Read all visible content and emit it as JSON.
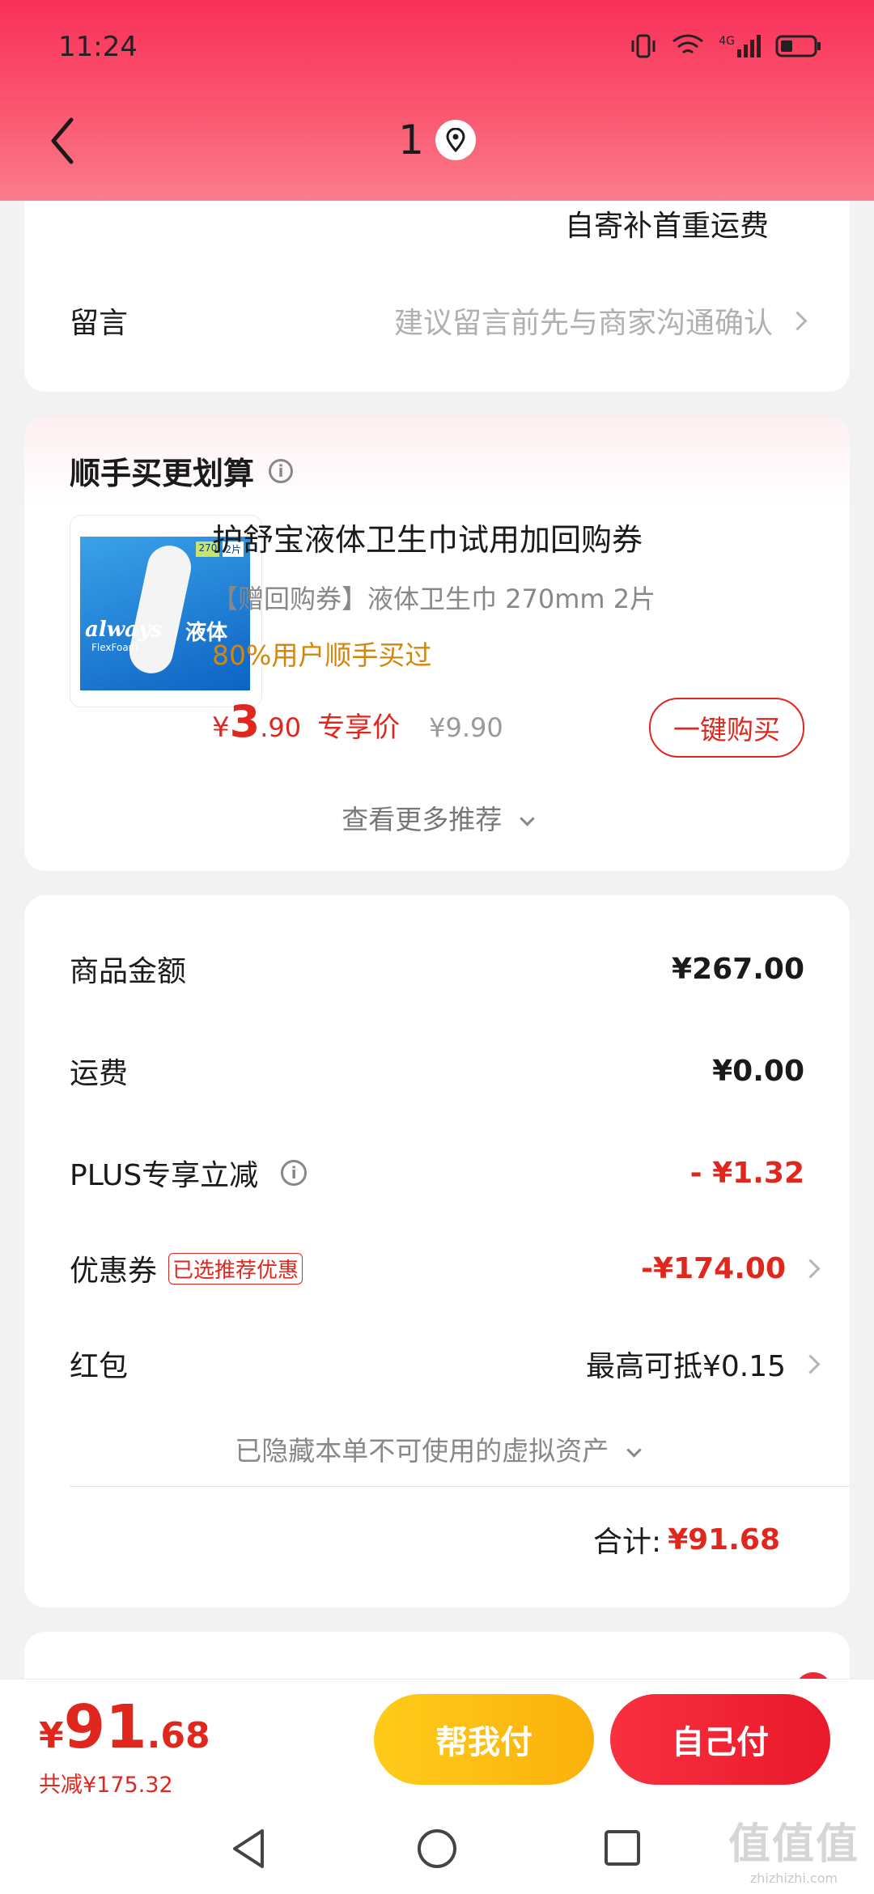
{
  "status": {
    "time": "11:24",
    "network": "4G"
  },
  "header": {
    "title": "1"
  },
  "address_card": {
    "shipping_note": "自寄补首重运费",
    "message_label": "留言",
    "message_placeholder": "建议留言前先与商家沟通确认"
  },
  "recommend": {
    "title": "顺手买更划算",
    "product": {
      "name": "护舒宝液体卫生巾试用加回购券",
      "desc": "【赠回购券】液体卫生巾 270mm 2片",
      "hint": "80%用户顺手买过",
      "currency": "¥",
      "price_int": "3",
      "price_dec": ".90",
      "price_tag": "专享价",
      "orig_price": "¥9.90",
      "buy_label": "一键购买",
      "image_brand": "always",
      "image_sub": "FlexFoam",
      "image_cn": "液体",
      "image_size": "270",
      "image_count": "2片"
    },
    "more_label": "查看更多推荐"
  },
  "summary": {
    "rows": [
      {
        "label": "商品金额",
        "value": "¥267.00"
      },
      {
        "label": "运费",
        "value": "¥0.00"
      },
      {
        "label": "PLUS专享立减",
        "value": "- ¥1.32"
      },
      {
        "label": "优惠券",
        "badge": "已选推荐优惠",
        "value": "-¥174.00"
      },
      {
        "label": "红包",
        "value": "最高可抵¥0.15"
      }
    ],
    "hidden_note": "已隐藏本单不可使用的虚拟资产",
    "total_label": "合计:",
    "total_value": "¥91.68"
  },
  "footer": {
    "currency": "¥",
    "total_int": "91",
    "total_dec": ".68",
    "saved": "共减¥175.32",
    "help_pay": "帮我付",
    "self_pay": "自己付"
  },
  "watermark": {
    "cn": "值值值",
    "en": "zhizhizhi.com"
  },
  "colors": {
    "accent": "#f9305a",
    "price_red": "#e0271e",
    "yellow": "#fbb10c",
    "hint_orange": "#d4860b"
  }
}
